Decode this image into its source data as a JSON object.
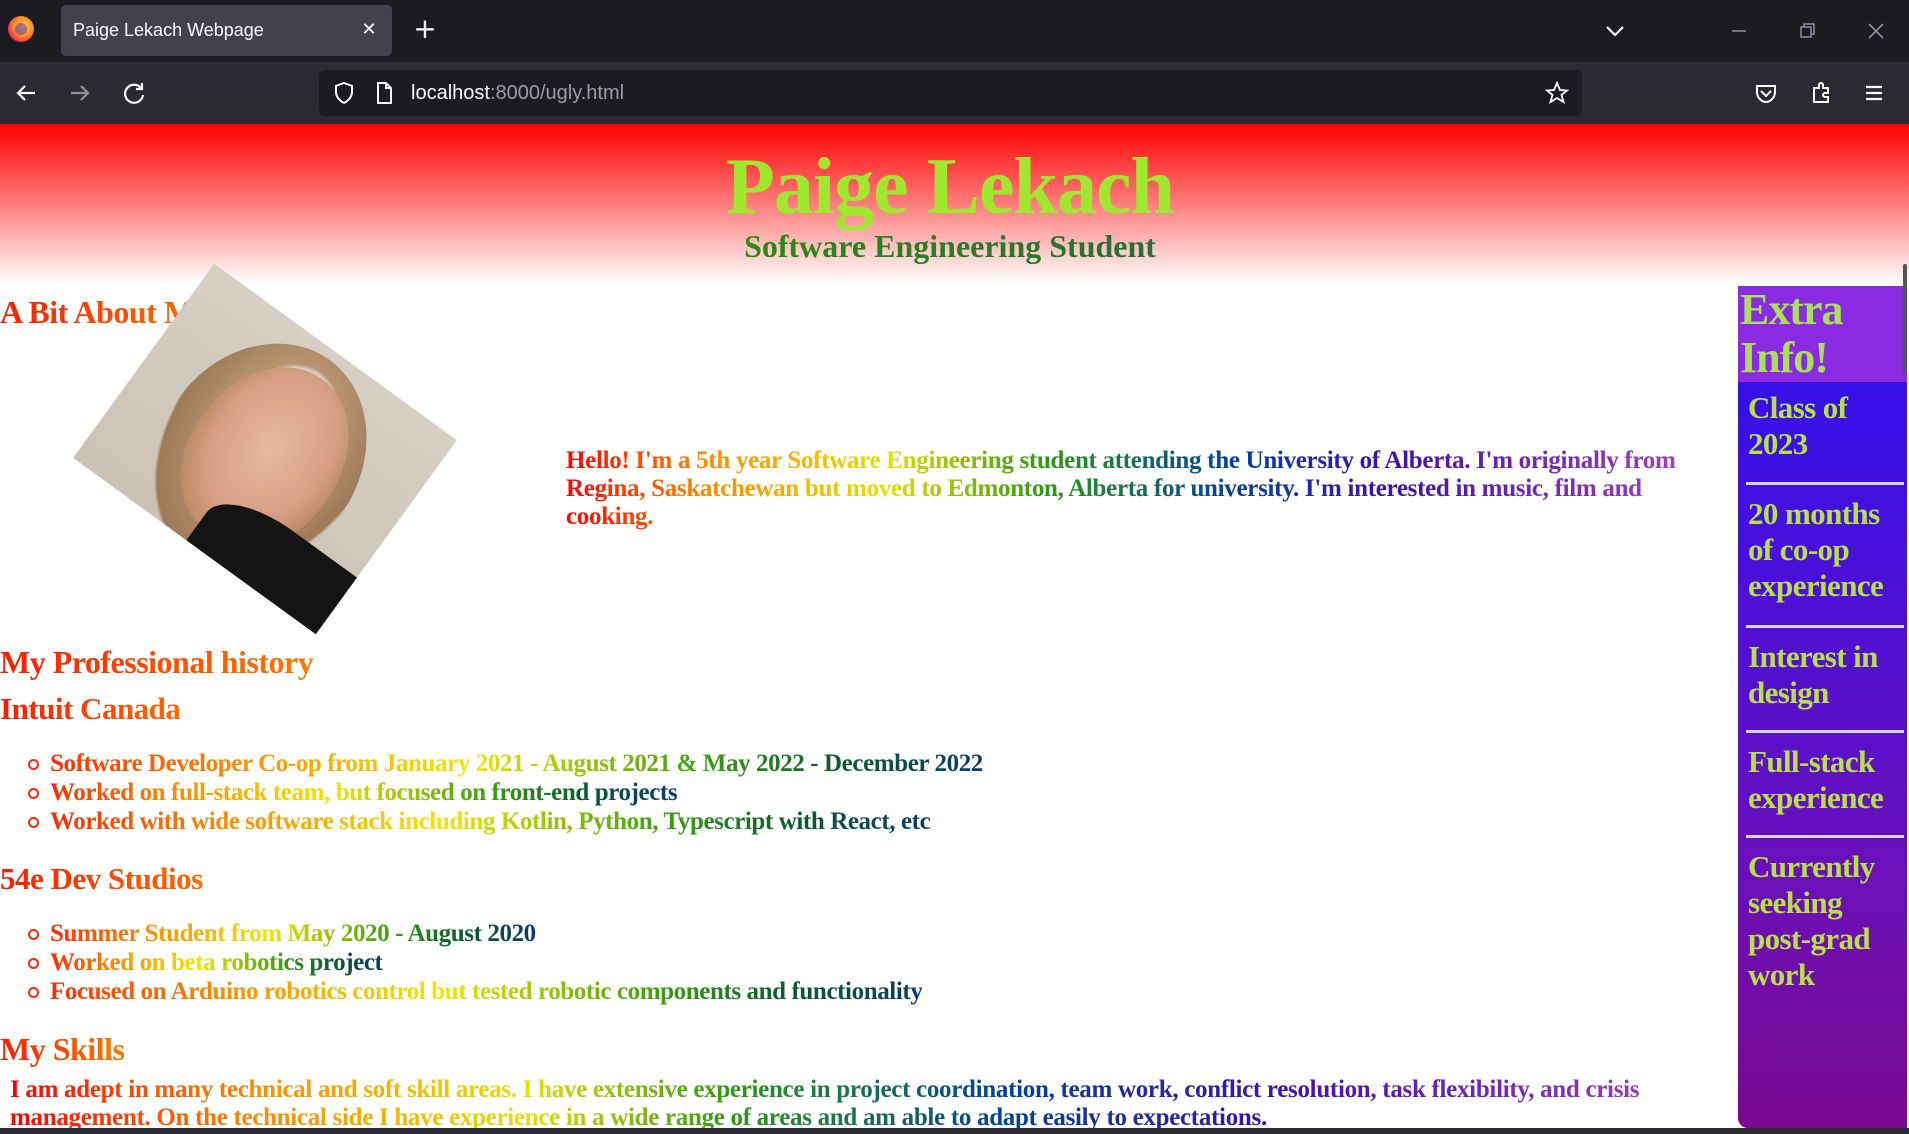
{
  "browser": {
    "tab_title": "Paige Lekach Webpage",
    "url_host": "localhost",
    "url_path": ":8000/ugly.html"
  },
  "header": {
    "title": "Paige Lekach",
    "subtitle": "Software Engineering Student"
  },
  "about": {
    "heading": "A Bit About Me!",
    "text": "Hello! I'm a 5th year Software Engineering student attending the University of Alberta. I'm originally from Regina, Saskatchewan but moved to Edmonton, Alberta for university. I'm interested in music, film and cooking."
  },
  "history": {
    "heading": "My Professional history",
    "jobs": [
      {
        "company": "Intuit Canada",
        "bullets": [
          "Software Developer Co-op from January 2021 - August 2021 & May 2022 - December 2022",
          "Worked on full-stack team, but focused on front-end projects",
          "Worked with wide software stack including Kotlin, Python, Typescript with React, etc"
        ]
      },
      {
        "company": "54e Dev Studios",
        "bullets": [
          "Summer Student from May 2020 - August 2020",
          "Worked on beta robotics project",
          "Focused on Arduino robotics control but tested robotic components and functionality"
        ]
      }
    ]
  },
  "skills": {
    "heading": "My Skills",
    "text": "I am adept in many technical and soft skill areas. I have extensive experience in project coordination, team work, conflict resolution, task flexibility, and crisis management. On the technical side I have experience in a wide range of areas and am able to adapt easily to expectations."
  },
  "sidebar": {
    "title": "Extra Info!",
    "items": [
      "Class of 2023",
      "20 months of co-op experience",
      "Interest in design",
      "Full-stack experience",
      "Currently seeking post-grad work"
    ]
  },
  "colors": {
    "header_gradient_top": "#ff0000",
    "title_color": "#a0e830",
    "sidebar_bg": "#4b10d8",
    "sidebar_text": "#b8e04a"
  },
  "icons": {
    "back": "arrow-left-icon",
    "forward": "arrow-right-icon",
    "reload": "reload-icon",
    "shield": "shield-icon",
    "page": "page-icon",
    "bookmark": "star-icon",
    "pocket": "pocket-icon",
    "extensions": "puzzle-icon",
    "menu": "hamburger-menu-icon"
  }
}
